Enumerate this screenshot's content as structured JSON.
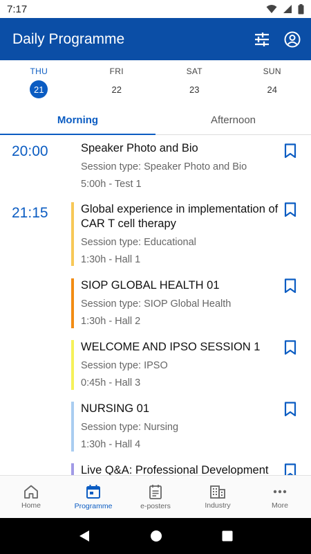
{
  "status": {
    "time": "7:17"
  },
  "header": {
    "title": "Daily Programme"
  },
  "days": [
    {
      "name": "THU",
      "num": "21"
    },
    {
      "name": "FRI",
      "num": "22"
    },
    {
      "name": "SAT",
      "num": "23"
    },
    {
      "name": "SUN",
      "num": "24"
    }
  ],
  "tabs": [
    {
      "label": "Morning"
    },
    {
      "label": "Afternoon"
    }
  ],
  "sessions": [
    {
      "time": "20:00",
      "title": "Speaker Photo and Bio",
      "type": "Session type: Speaker Photo and Bio",
      "detail": "5:00h - Test 1",
      "color": "#ffffff"
    },
    {
      "time": "21:15",
      "title": "Global experience in implementation of CAR T cell therapy",
      "type": "Session type: Educational",
      "detail": "1:30h - Hall 1",
      "color": "#f7c857"
    },
    {
      "time": "",
      "title": "SIOP GLOBAL HEALTH 01",
      "type": "Session type: SIOP Global Health",
      "detail": "1:30h - Hall 2",
      "color": "#f28c14"
    },
    {
      "time": "",
      "title": "WELCOME AND IPSO SESSION 1",
      "type": "Session type: IPSO",
      "detail": "0:45h - Hall 3",
      "color": "#f5f15a"
    },
    {
      "time": "",
      "title": "NURSING 01",
      "type": "Session type: Nursing",
      "detail": "1:30h - Hall 4",
      "color": "#a9cdf1"
    },
    {
      "time": "",
      "title": "Live Q&A: Professional Development",
      "type": "",
      "detail": "",
      "color": "#a19ae6"
    }
  ],
  "nav": [
    {
      "label": "Home",
      "icon": "home-icon"
    },
    {
      "label": "Programme",
      "icon": "calendar-icon"
    },
    {
      "label": "e-posters",
      "icon": "poster-icon"
    },
    {
      "label": "Industry",
      "icon": "building-icon"
    },
    {
      "label": "More",
      "icon": "more-icon"
    }
  ],
  "colors": {
    "primary": "#0b4ea6",
    "accent": "#0b5cc2"
  }
}
